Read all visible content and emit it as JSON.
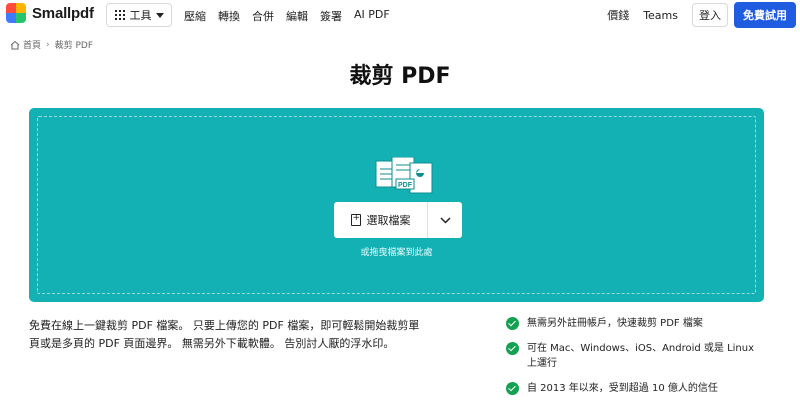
{
  "header": {
    "logo_text": "Smallpdf",
    "tools_label": "工具",
    "nav": [
      "壓縮",
      "轉換",
      "合併",
      "編輯",
      "簽署",
      "AI PDF"
    ],
    "pricing": "價錢",
    "teams": "Teams",
    "login": "登入",
    "trial": "免費試用"
  },
  "breadcrumb": {
    "home": "首頁",
    "current": "裁剪 PDF"
  },
  "page_title": "裁剪 PDF",
  "dropzone": {
    "select_label": "選取檔案",
    "hint": "或拖曳檔案到此處",
    "pdf_badge": "PDF"
  },
  "description": [
    "免費在線上一鍵裁剪 PDF 檔案。 只要上傳您的 PDF 檔案，即可輕鬆開始裁剪單",
    "頁或是多頁的 PDF 頁面邊界。 無需另外下載軟體。 告別討人厭的浮水印。"
  ],
  "features": [
    "無需另外註冊帳戶，快速裁剪 PDF 檔案",
    "可在 Mac、Windows、iOS、Android 或是 Linux 上運行",
    "自 2013 年以來，受到超過 10 億人的信任"
  ],
  "colors": {
    "brand_blue": "#1f5ce0",
    "dropzone_teal": "#14b1b4",
    "check_green": "#12a150"
  }
}
